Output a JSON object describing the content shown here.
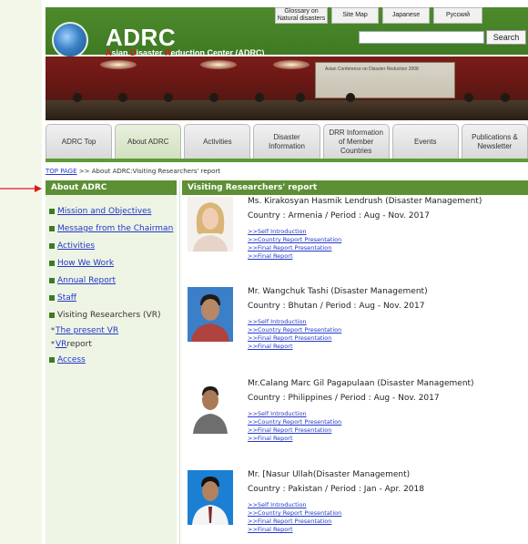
{
  "header": {
    "title": "ADRC",
    "subtitle_parts": [
      "A",
      "sian ",
      "D",
      "isaster ",
      "R",
      "eduction Center (ADRC)"
    ],
    "top_links": [
      "Glossary on Natural disasters",
      "Site Map",
      "Japanese",
      "Русский"
    ],
    "search_label": "Search",
    "search_value": ""
  },
  "banner": {
    "screen_text": "Asian Conference on Disaster Reduction 2008"
  },
  "tabs": [
    "ADRC Top",
    "About ADRC",
    "Activities",
    "Disaster Information",
    "DRR Information of Member Countries",
    "Events",
    "Publications & Newsletter"
  ],
  "active_tab": "About ADRC",
  "breadcrumb": {
    "home": "TOP PAGE",
    "rest": " >> About ADRC:Visiting Researchers' report"
  },
  "sidebar": {
    "title": "About ADRC",
    "items": [
      {
        "label": "Mission and Objectives"
      },
      {
        "label": "Message from the Chairman"
      },
      {
        "label": "Activities"
      },
      {
        "label": "How We Work"
      },
      {
        "label": "Annual Report"
      },
      {
        "label": "Staff"
      },
      {
        "label": "Visiting Researchers (VR)"
      }
    ],
    "sub_items": [
      {
        "label": "The present VR",
        "suffix": ""
      },
      {
        "label": "VR",
        "suffix": " report"
      }
    ],
    "last_item": {
      "label": "Access"
    }
  },
  "main": {
    "title": "Visiting Researchers' report",
    "researchers": [
      {
        "name": "Ms. Kirakosyan Hasmik Lendrush (Disaster Management)",
        "country": "Country : Armenia / Period : Aug - Nov. 2017",
        "links": [
          ">>Self Introduction",
          ">>Country Report Presentation",
          ">>Final Report Presentation",
          ">>Final Report"
        ]
      },
      {
        "name": "Mr. Wangchuk Tashi (Disaster Management)",
        "country": "Country : Bhutan / Period : Aug - Nov. 2017",
        "links": [
          ">>Self Introduction",
          ">>Country Report Presentation",
          ">>Final Report Presentation",
          ">>Final Report"
        ]
      },
      {
        "name": "Mr.Calang Marc Gil Pagapulaan (Disaster Management)",
        "country": "Country : Philippines / Period : Aug - Nov. 2017",
        "links": [
          ">>Self Introduction",
          ">>Country Report Presentation",
          ">>Final Report Presentation",
          ">>Final Report"
        ]
      },
      {
        "name": "Mr. [Nasur Ullah(Disaster Management)",
        "country": "Country : Pakistan / Period : Jan - Apr. 2018",
        "links": [
          ">>Self Introduction",
          ">>Country Report Presentation",
          ">>Final Report Presentation",
          ">>Final Report"
        ]
      }
    ]
  },
  "colors": {
    "header_green": "#4d8a2c",
    "section_green": "#5d8f35",
    "link_blue": "#2238c9",
    "sidebar_bg": "#eef4e4",
    "annotation_arrow": "#d71b1b"
  }
}
